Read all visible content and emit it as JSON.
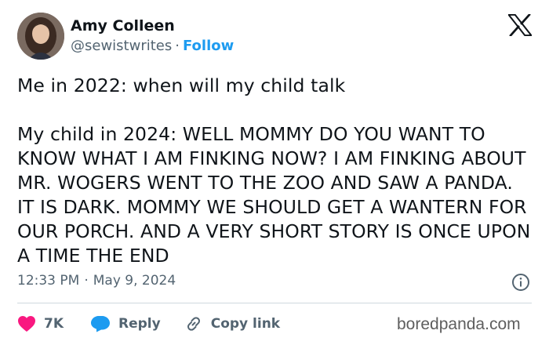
{
  "author": {
    "name": "Amy Colleen",
    "handle": "@sewistwrites",
    "separator": "·",
    "follow_label": "Follow"
  },
  "tweet": {
    "text": "Me in 2022: when will my child talk\n\nMy child in 2024: WELL MOMMY DO YOU WANT TO KNOW WHAT I AM FINKING NOW? I AM FINKING ABOUT  MR. WOGERS WENT TO THE ZOO AND SAW A PANDA. IT IS DARK. MOMMY WE SHOULD GET A WANTERN FOR OUR PORCH. AND A VERY SHORT STORY IS ONCE UPON A TIME THE END",
    "time": "12:33 PM",
    "separator": "·",
    "date": "May 9, 2024"
  },
  "actions": {
    "like_count": "7K",
    "reply_label": "Reply",
    "copy_link_label": "Copy link"
  },
  "watermark": "boredpanda.com",
  "colors": {
    "text": "#0f1419",
    "muted": "#536471",
    "accent": "#1d9bf0",
    "like": "#f91880",
    "divider": "#cfd9de"
  },
  "icons": {
    "brand": "x-logo-icon",
    "info": "info-icon",
    "like": "heart-icon",
    "reply": "reply-bubble-icon",
    "copy": "link-icon"
  }
}
